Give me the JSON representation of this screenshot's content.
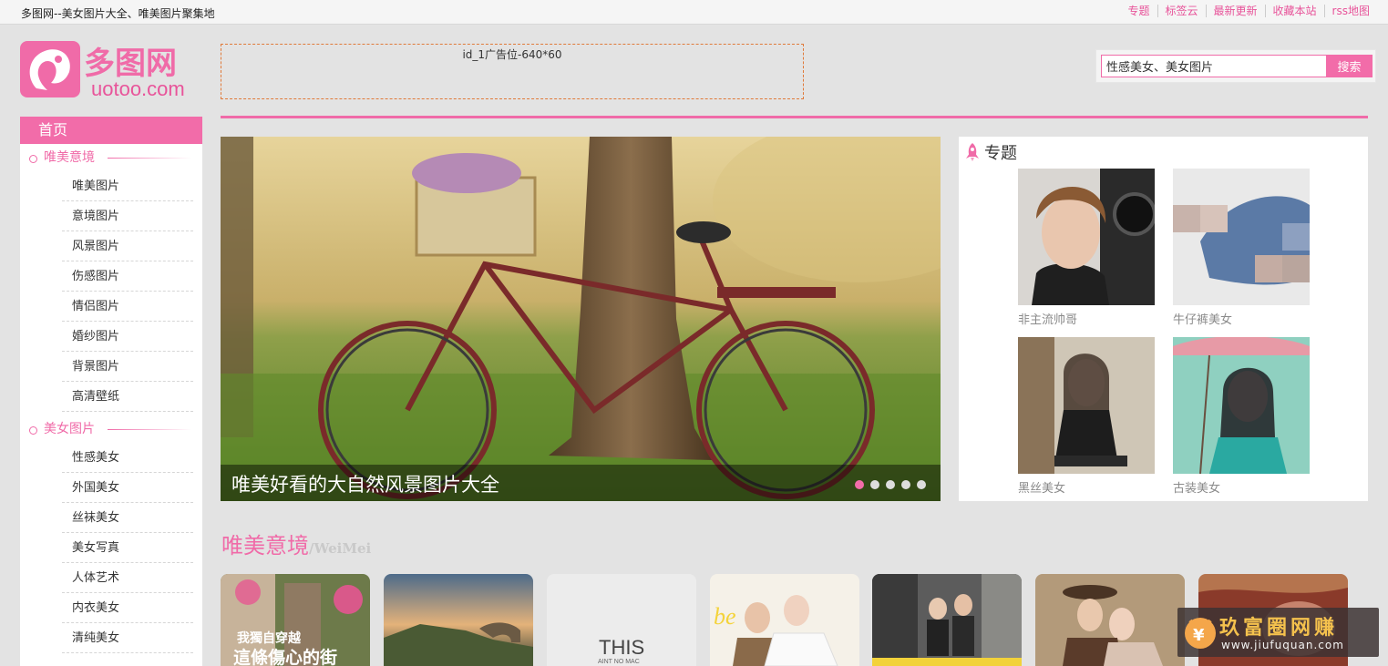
{
  "site": {
    "title": "多图网--美女图片大全、唯美图片聚集地",
    "logo_text": "多图网",
    "logo_domain": "uotoo.com"
  },
  "toplinks": [
    "专题",
    "标签云",
    "最新更新",
    "收藏本站",
    "rss地图"
  ],
  "ad": {
    "label": "id_1广告位-640*60"
  },
  "search": {
    "value": "性感美女、美女图片",
    "button": "搜索"
  },
  "sidebar": {
    "home": "首页",
    "categories": [
      {
        "title": "唯美意境",
        "items": [
          "唯美图片",
          "意境图片",
          "风景图片",
          "伤感图片",
          "情侣图片",
          "婚纱图片",
          "背景图片",
          "高清壁纸"
        ]
      },
      {
        "title": "美女图片",
        "items": [
          "性感美女",
          "外国美女",
          "丝袜美女",
          "美女写真",
          "人体艺术",
          "内衣美女",
          "清纯美女"
        ]
      }
    ]
  },
  "slider": {
    "caption": "唯美好看的大自然风景图片大全",
    "slide_count": 5,
    "active_index": 0
  },
  "topics": {
    "title": "专题",
    "items": [
      {
        "label": "非主流帅哥"
      },
      {
        "label": "牛仔裤美女"
      },
      {
        "label": "黑丝美女"
      },
      {
        "label": "古装美女"
      }
    ]
  },
  "section": {
    "title": "唯美意境",
    "subtitle": "/WeiMei",
    "thumbs": [
      {
        "text": "我獨自穿越\n這條傷心的街"
      },
      {
        "text": ""
      },
      {
        "text": "THIS\nAINT NO MAC"
      },
      {
        "text": ""
      },
      {
        "text": ""
      },
      {
        "text": ""
      },
      {
        "text": ""
      }
    ]
  },
  "watermark": {
    "text": "玖富圈网赚",
    "url": "www.jiufuquan.com"
  },
  "colors": {
    "accent": "#f26ca9",
    "background": "#e3e3e3"
  }
}
